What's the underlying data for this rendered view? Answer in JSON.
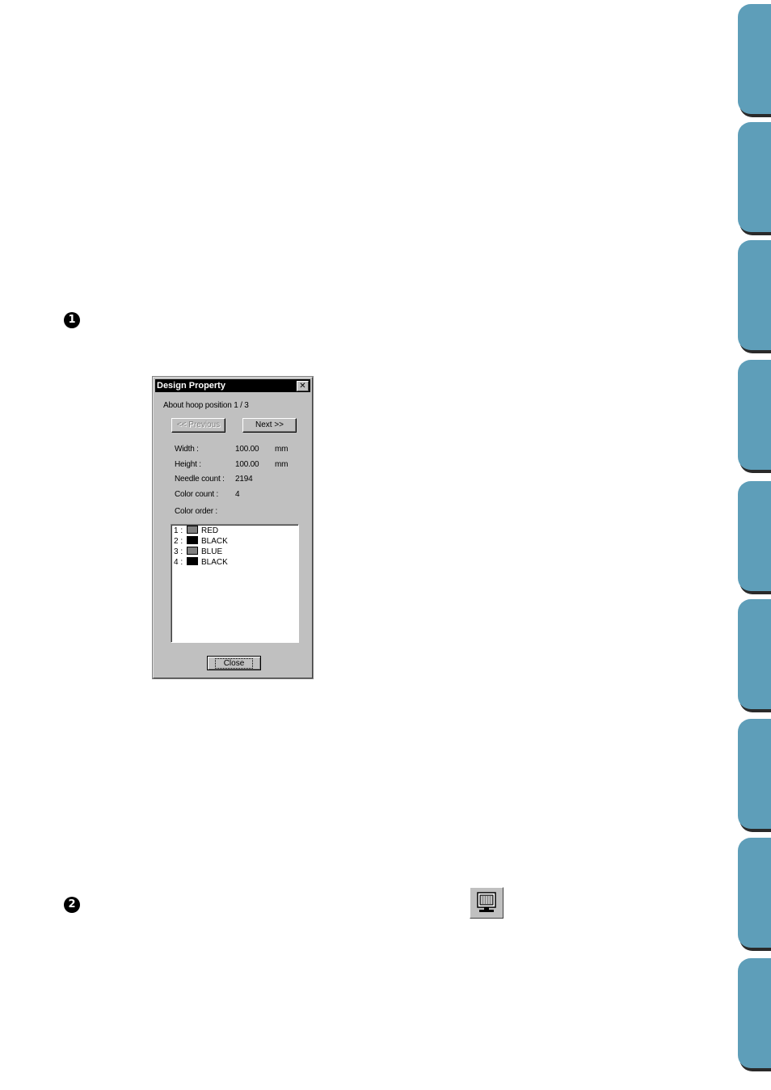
{
  "steps": {
    "step1": "1",
    "step2": "2"
  },
  "dialog": {
    "title": "Design Property",
    "close_symbol": "✕",
    "hoop_label": "About hoop position",
    "hoop_value": "1 / 3",
    "previous_label": "<< Previous",
    "next_label": "Next >>",
    "width_label": "Width :",
    "width_value": "100.00",
    "width_unit": "mm",
    "height_label": "Height :",
    "height_value": "100.00",
    "height_unit": "mm",
    "needle_label": "Needle count :",
    "needle_value": "2194",
    "color_count_label": "Color count :",
    "color_count_value": "4",
    "color_order_label": "Color order :",
    "colors": [
      {
        "index": "1 :",
        "name": "RED",
        "swatch": "#7f7f7f"
      },
      {
        "index": "2 :",
        "name": "BLACK",
        "swatch": "#000000"
      },
      {
        "index": "3 :",
        "name": "BLUE",
        "swatch": "#7f7f7f"
      },
      {
        "index": "4 :",
        "name": "BLACK",
        "swatch": "#000000"
      }
    ],
    "close_label": "Close"
  },
  "theme": {
    "tab_color": "#5e9eb9"
  },
  "toolbar_icon": "sewing-machine-icon"
}
